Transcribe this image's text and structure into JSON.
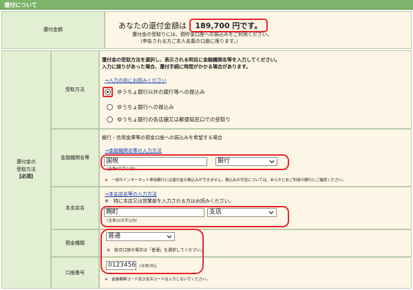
{
  "section_title": "還付について",
  "refund_amount": {
    "label": "還付金額",
    "prefix": "あなたの還付金額は",
    "value": "189,700 円です。",
    "note_1": "還付金の受取りには、預貯金口座への振込みをご利用ください。",
    "note_2": "（申告される方ご本人名義の口座に限ります。）"
  },
  "refund_receipt": {
    "label_line1": "還付金の",
    "label_line2": "受取方法",
    "required": "【必須】"
  },
  "method": {
    "label": "受取方法",
    "instruction_1": "還付金の受取方法を選択し、表示される明目に金融機関名等を入力してください。",
    "instruction_2": "入力に誤りがあった場合、還付手続に時間がかかる場合があります。",
    "link": "→入力の前にお読みください",
    "options": [
      "ゆうちょ銀行以外の銀行等への振込み",
      "ゆうちょ銀行への振込み",
      "ゆうちょ銀行の各店舗又は郵便局窓口での受取り"
    ]
  },
  "bank_name": {
    "label": "金融機関名等",
    "desc": "銀行・信用金庫等の預金口座への振込みを希望する場合",
    "link": "→金融機関名等の入力方法",
    "value": "国税",
    "hint": "（全角6文字以内）",
    "type_selected": "銀行",
    "note": "※　一部のインターネット専用銀行には還付金の振込みができません。振込みの可否については、あらかじめご利用の銀行にご確認ください。"
  },
  "branch": {
    "label": "本支店名",
    "link": "→本支店名等の入力方法",
    "note": "※　特に本店又は営業部を入力される方はお読みください。",
    "value": "麹町",
    "hint": "（全角10文字以内）",
    "type_selected": "支店"
  },
  "deposit_type": {
    "label": "預金種類",
    "selected": "普通",
    "note": "※　総合口座の場合は「普通」を選択してください。"
  },
  "account_number": {
    "label": "口座番号",
    "value": "0123456",
    "hint": "[半角7桁]",
    "note": "※　金融機関コード及び支店コードは入力しないでください。"
  },
  "colors": {
    "header_green": "#7db36b",
    "label_green": "#e3efd3",
    "value_cream": "#fdf6e6",
    "highlight_red": "#e8212b",
    "link_blue": "#1a3fb0"
  }
}
